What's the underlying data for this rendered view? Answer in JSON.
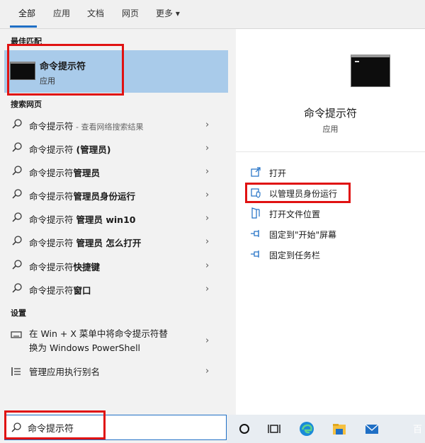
{
  "tabs": [
    {
      "label": "全部",
      "active": true
    },
    {
      "label": "应用"
    },
    {
      "label": "文档"
    },
    {
      "label": "网页"
    },
    {
      "label": "更多 ▾"
    }
  ],
  "left": {
    "best_match_header": "最佳匹配",
    "best_match": {
      "title": "命令提示符",
      "subtitle": "应用",
      "icon": "cmd-window-icon"
    },
    "web_header": "搜索网页",
    "web_results": [
      {
        "text": "命令提示符",
        "muted": " - 查看网络搜索结果"
      },
      {
        "text": "命令提示符 ",
        "bold": "(管理员)"
      },
      {
        "text": "命令提示符",
        "bold": "管理员"
      },
      {
        "text": "命令提示符",
        "bold": "管理员身份运行"
      },
      {
        "text": "命令提示符 ",
        "bold": "管理员 win10"
      },
      {
        "text": "命令提示符 ",
        "bold": "管理员 怎么打开"
      },
      {
        "text": "命令提示符",
        "bold": "快捷键"
      },
      {
        "text": "命令提示符",
        "bold": "窗口"
      }
    ],
    "settings_header": "设置",
    "settings": [
      {
        "line1": "在 Win + X 菜单中将命令提示符替",
        "line2": "换为 Windows PowerShell",
        "icon": "keyboard-icon"
      },
      {
        "line1": "管理应用执行别名",
        "icon": "list-icon"
      }
    ]
  },
  "right": {
    "title": "命令提示符",
    "subtitle": "应用",
    "actions": [
      {
        "label": "打开",
        "icon": "open-icon"
      },
      {
        "label": "以管理员身份运行",
        "icon": "shield-icon"
      },
      {
        "label": "打开文件位置",
        "icon": "file-location-icon"
      },
      {
        "label": "固定到\"开始\"屏幕",
        "icon": "pin-icon"
      },
      {
        "label": "固定到任务栏",
        "icon": "pin-icon"
      }
    ]
  },
  "search": {
    "value": "命令提示符",
    "icon": "search-icon"
  },
  "taskbar": {
    "icons": [
      "cortana-icon",
      "task-view-icon",
      "edge-icon",
      "file-explorer-icon",
      "mail-icon"
    ],
    "corner_text": "百"
  },
  "colors": {
    "accent": "#1f6fc5",
    "highlight": "#a9cbea",
    "annotation": "#e01212"
  }
}
